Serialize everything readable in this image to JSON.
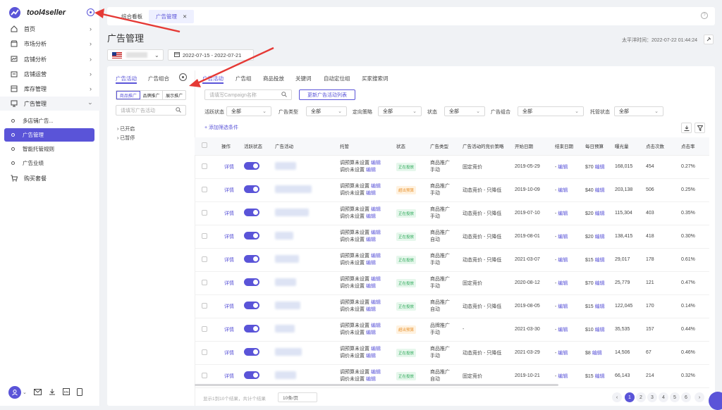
{
  "sidebar": {
    "brand": "tool4seller",
    "items": [
      {
        "label": "首页",
        "icon": "home-icon"
      },
      {
        "label": "市场分析",
        "icon": "market-icon"
      },
      {
        "label": "店铺分析",
        "icon": "chart-icon"
      },
      {
        "label": "店铺运营",
        "icon": "store-icon"
      },
      {
        "label": "库存管理",
        "icon": "inventory-icon"
      },
      {
        "label": "广告管理",
        "icon": "monitor-icon"
      }
    ],
    "subitems": [
      {
        "label": "多店铺广告..."
      },
      {
        "label": "广告管理"
      },
      {
        "label": "智能托管规则"
      },
      {
        "label": "广告业绩"
      }
    ],
    "buy": "购买套餐"
  },
  "topbar": {
    "tabs": [
      {
        "label": "综合看板"
      },
      {
        "label": "广告管理"
      }
    ]
  },
  "header": {
    "title": "广告管理",
    "time_label": "太平洋时间：2022-07-22 01:44:24",
    "date_range": "2022-07-15 - 2022-07-21"
  },
  "left_panel": {
    "tabs": [
      "广告活动",
      "广告组合"
    ],
    "type_tabs": [
      "商品推广",
      "品牌推广",
      "展示推广"
    ],
    "search_placeholder": "请填写广告活动",
    "tree": [
      "已开启",
      "已暂停"
    ]
  },
  "content_tabs": [
    "广告活动",
    "广告组",
    "商品投放",
    "关键词",
    "自动定位组",
    "买家搜索词"
  ],
  "search": {
    "placeholder": "请填写Campaign名称",
    "update_button": "更新广告活动列表"
  },
  "filters": [
    {
      "label": "活跃状态",
      "value": "全部"
    },
    {
      "label": "广告类型",
      "value": "全部"
    },
    {
      "label": "定向策略",
      "value": "全部"
    },
    {
      "label": "状态",
      "value": "全部"
    },
    {
      "label": "广告组合",
      "value": "全部"
    },
    {
      "label": "托管状态",
      "value": "全部"
    }
  ],
  "add_filter": "+ 添加筛选条件",
  "table": {
    "columns": [
      "",
      "操作",
      "活跃状态",
      "广告活动",
      "托管",
      "状态",
      "广告类型",
      "广告活动的竞价策略",
      "开始日期",
      "结束日期",
      "每日预算",
      "曝光量",
      "点击次数",
      "点击率"
    ],
    "rows": [
      {
        "action": "详情",
        "trust1": "调预算未设置",
        "trust2": "调价未设置",
        "edit": "编辑",
        "status": "正在投放",
        "st": "on",
        "type1": "商品推广",
        "type2": "手动",
        "strategy": "固定竞价",
        "start": "2019-05-29",
        "end": "-",
        "budget": "$70",
        "impr": "168,015",
        "clicks": "454",
        "ctr": "0.27%"
      },
      {
        "action": "详情",
        "trust1": "调预算未设置",
        "trust2": "调价未设置",
        "edit": "编辑",
        "status": "超出预算",
        "st": "pause",
        "type1": "商品推广",
        "type2": "手动",
        "strategy": "动态竞价 - 只降低",
        "start": "2019-10-09",
        "end": "-",
        "budget": "$40",
        "impr": "203,138",
        "clicks": "506",
        "ctr": "0.25%"
      },
      {
        "action": "详情",
        "trust1": "调预算未设置",
        "trust2": "调价未设置",
        "edit": "编辑",
        "status": "正在投放",
        "st": "on",
        "type1": "商品推广",
        "type2": "手动",
        "strategy": "动态竞价 - 只降低",
        "start": "2019-07-10",
        "end": "-",
        "budget": "$20",
        "impr": "115,304",
        "clicks": "403",
        "ctr": "0.35%"
      },
      {
        "action": "详情",
        "trust1": "调预算未设置",
        "trust2": "调价未设置",
        "edit": "编辑",
        "status": "正在投放",
        "st": "on",
        "type1": "商品推广",
        "type2": "自动",
        "strategy": "动态竞价 - 只降低",
        "start": "2019-08-01",
        "end": "-",
        "budget": "$20",
        "impr": "138,415",
        "clicks": "418",
        "ctr": "0.30%"
      },
      {
        "action": "详情",
        "trust1": "调预算未设置",
        "trust2": "调价未设置",
        "edit": "编辑",
        "status": "正在投放",
        "st": "on",
        "type1": "商品推广",
        "type2": "手动",
        "strategy": "动态竞价 - 只降低",
        "start": "2021-03-07",
        "end": "-",
        "budget": "$15",
        "impr": "29,017",
        "clicks": "178",
        "ctr": "0.61%"
      },
      {
        "action": "详情",
        "trust1": "调预算未设置",
        "trust2": "调价未设置",
        "edit": "编辑",
        "status": "正在投放",
        "st": "on",
        "type1": "商品推广",
        "type2": "手动",
        "strategy": "固定竞价",
        "start": "2020-08-12",
        "end": "-",
        "budget": "$70",
        "impr": "25,779",
        "clicks": "121",
        "ctr": "0.47%"
      },
      {
        "action": "详情",
        "trust1": "调预算未设置",
        "trust2": "调价未设置",
        "edit": "编辑",
        "status": "正在投放",
        "st": "on",
        "type1": "商品推广",
        "type2": "自动",
        "strategy": "动态竞价 - 只降低",
        "start": "2019-08-05",
        "end": "-",
        "budget": "$15",
        "impr": "122,045",
        "clicks": "170",
        "ctr": "0.14%"
      },
      {
        "action": "详情",
        "trust1": "调预算未设置",
        "trust2": "调价未设置",
        "edit": "编辑",
        "status": "超出预算",
        "st": "pause",
        "type1": "品牌推广",
        "type2": "手动",
        "strategy": "-",
        "start": "2021-03-30",
        "end": "-",
        "budget": "$10",
        "impr": "35,535",
        "clicks": "157",
        "ctr": "0.44%"
      },
      {
        "action": "详情",
        "trust1": "调预算未设置",
        "trust2": "调价未设置",
        "edit": "编辑",
        "status": "正在投放",
        "st": "on",
        "type1": "商品推广",
        "type2": "手动",
        "strategy": "动态竞价 - 只降低",
        "start": "2021-03-29",
        "end": "-",
        "budget": "$8",
        "impr": "14,506",
        "clicks": "67",
        "ctr": "0.46%"
      },
      {
        "action": "详情",
        "trust1": "调预算未设置",
        "trust2": "调价未设置",
        "edit": "编辑",
        "status": "正在投放",
        "st": "on",
        "type1": "商品推广",
        "type2": "自动",
        "strategy": "固定竞价",
        "start": "2019-10-21",
        "end": "-",
        "budget": "$15",
        "impr": "66,143",
        "clicks": "214",
        "ctr": "0.32%"
      }
    ]
  },
  "pagination": {
    "pages": [
      "1",
      "2",
      "3",
      "4",
      "5",
      "6"
    ],
    "page_size": "10条/页",
    "summary": "显示1到10个结果，共计个结果"
  },
  "colors": {
    "accent": "#5a54d8",
    "arrow": "#e53935"
  }
}
